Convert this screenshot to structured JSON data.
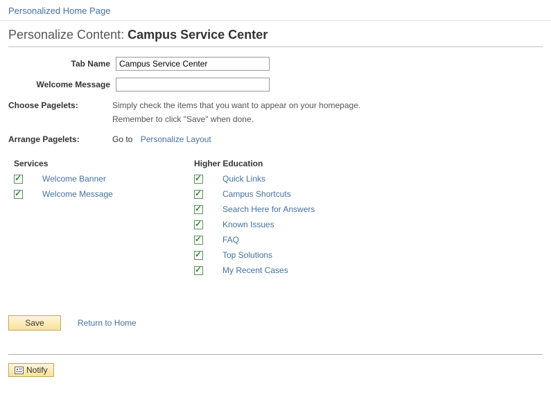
{
  "breadcrumb": {
    "text": "Personalized Home Page"
  },
  "title": {
    "prefix": "Personalize Content: ",
    "subject": "Campus Service Center"
  },
  "form": {
    "tabName": {
      "label": "Tab Name",
      "value": "Campus Service Center"
    },
    "welcomeMessage": {
      "label": "Welcome Message",
      "value": ""
    }
  },
  "choosePagelets": {
    "label": "Choose Pagelets:",
    "line1": "Simply check the items that you want to appear on your homepage.",
    "line2": "Remember to click \"Save\" when done."
  },
  "arrangePagelets": {
    "label": "Arrange Pagelets:",
    "goto": "Go to",
    "link": "Personalize Layout"
  },
  "columns": [
    {
      "header": "Services",
      "items": [
        {
          "label": "Welcome Banner",
          "checked": true
        },
        {
          "label": "Welcome Message",
          "checked": true
        }
      ]
    },
    {
      "header": "Higher Education",
      "items": [
        {
          "label": "Quick Links",
          "checked": true
        },
        {
          "label": "Campus Shortcuts",
          "checked": true
        },
        {
          "label": "Search Here for Answers",
          "checked": true
        },
        {
          "label": "Known Issues",
          "checked": true
        },
        {
          "label": "FAQ",
          "checked": true
        },
        {
          "label": "Top Solutions",
          "checked": true
        },
        {
          "label": "My Recent Cases",
          "checked": true
        }
      ]
    }
  ],
  "buttons": {
    "save": "Save",
    "returnHome": "Return to Home",
    "notify": "Notify"
  }
}
